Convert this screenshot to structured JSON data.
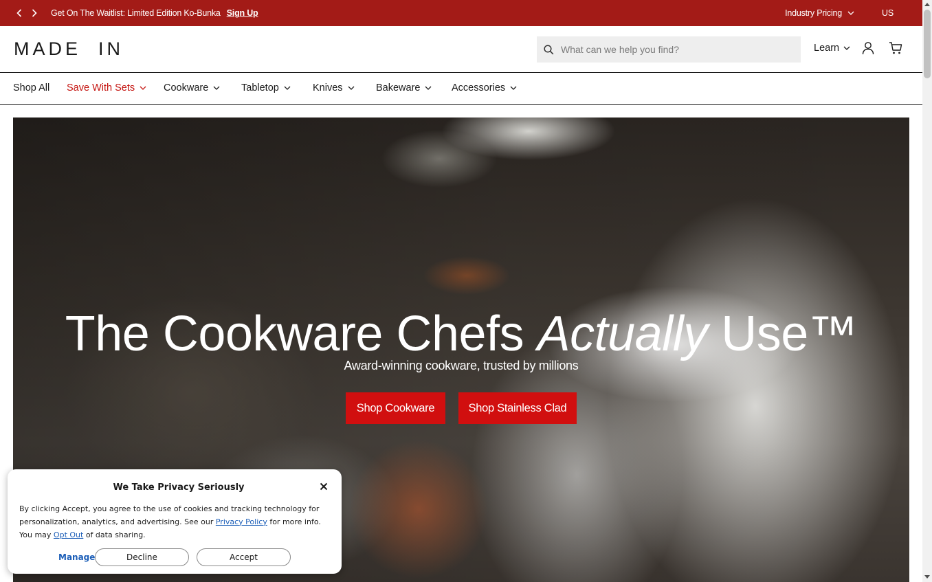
{
  "announcement": {
    "message": "Get On The Waitlist: Limited Edition Ko-Bunka",
    "link": "Sign Up",
    "industry_pricing": "Industry Pricing",
    "region": "US"
  },
  "header": {
    "logo": "MADE  IN",
    "search_placeholder": "What can we help you find?",
    "learn": "Learn"
  },
  "nav": {
    "items": [
      {
        "label": "Shop All"
      },
      {
        "label": "Save With Sets"
      },
      {
        "label": "Cookware"
      },
      {
        "label": "Tabletop"
      },
      {
        "label": "Knives"
      },
      {
        "label": "Bakeware"
      },
      {
        "label": "Accessories"
      }
    ]
  },
  "hero": {
    "title_part1": "The Cookware Chefs ",
    "title_italic": "Actually",
    "title_part2": " Use™",
    "subtitle": "Award-winning cookware, trusted by millions",
    "button1": "Shop Cookware",
    "button2": "Shop Stainless Clad"
  },
  "privacy": {
    "title": "We Take Privacy Seriously",
    "text1": "By clicking Accept, you agree to the use of cookies and tracking technology for personalization, analytics, and advertising. See our ",
    "policy_link": "Privacy Policy",
    "text2": " for more info. You may ",
    "opt_out_link": "Opt Out",
    "text3": " of data sharing.",
    "manage": "Manage",
    "decline": "Decline",
    "accept": "Accept"
  },
  "colors": {
    "announcement_bg": "#a31b17",
    "accent_red": "#d10f0f",
    "nav_red": "#c4120e",
    "link_blue": "#1d5fb8"
  }
}
